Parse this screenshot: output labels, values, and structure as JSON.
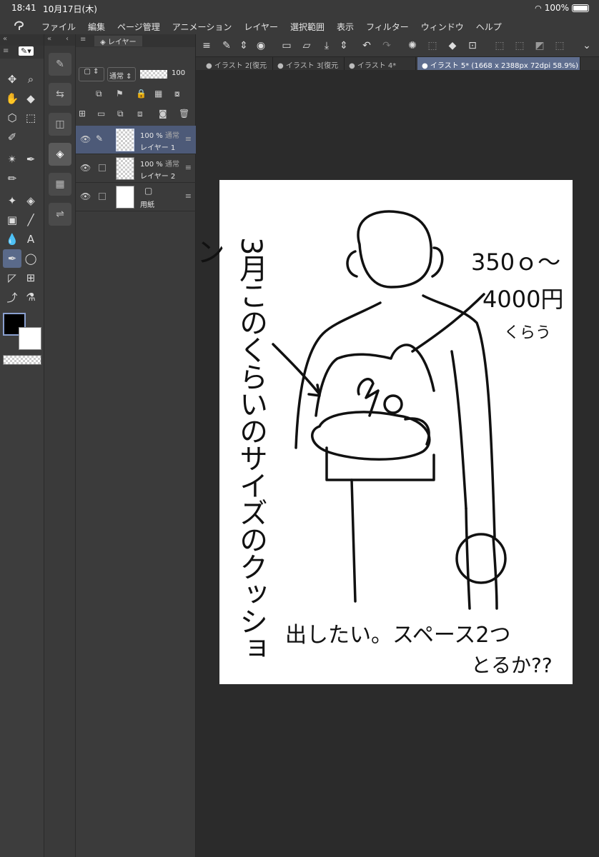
{
  "status": {
    "time": "18:41",
    "date": "10月17日(木)",
    "battery": "100%"
  },
  "menu": [
    "ファイル",
    "編集",
    "ページ管理",
    "アニメーション",
    "レイヤー",
    "選択範囲",
    "表示",
    "フィルター",
    "ウィンドウ",
    "ヘルプ"
  ],
  "layer_panel": {
    "title": "レイヤー",
    "blend_mode": "通常",
    "opacity": "100",
    "layers": [
      {
        "opacity": "100 %",
        "mode": "通常",
        "name": "レイヤー 1",
        "selected": true
      },
      {
        "opacity": "100 %",
        "mode": "通常",
        "name": "レイヤー 2",
        "selected": false
      },
      {
        "opacity": "",
        "mode": "",
        "name": "用紙",
        "selected": false
      }
    ]
  },
  "tabs": [
    {
      "label": "イラスト 2[復元",
      "active": false
    },
    {
      "label": "イラスト 3[復元",
      "active": false
    },
    {
      "label": "イラスト 4*",
      "active": false
    },
    {
      "label": "イラスト 5* (1668 x 2388px 72dpi 58.9%)",
      "active": true
    }
  ],
  "canvas_text": {
    "left_vertical": "3月このくらいのサイズのクッション",
    "price": [
      "350ｏ〜",
      "4000円",
      "くらう"
    ],
    "bottom": [
      "出したい。スペース2つ",
      "とるか??"
    ]
  },
  "colors": {
    "main": "#000000",
    "sub": "#ffffff",
    "accent": "#5f6e8f"
  }
}
